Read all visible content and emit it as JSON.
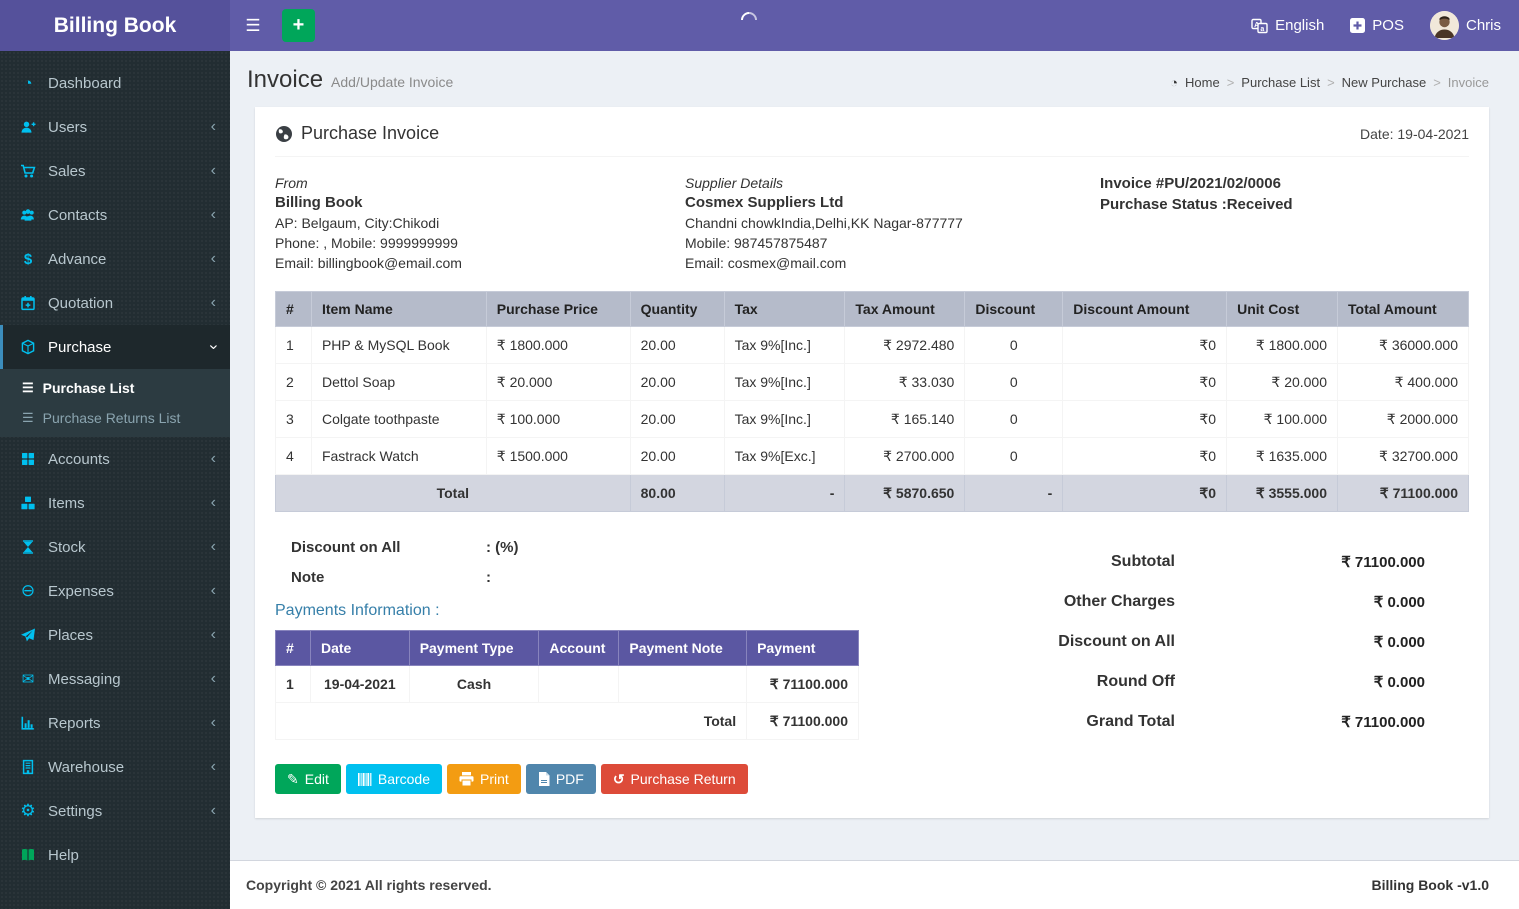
{
  "icons": {
    "hamburger": "☰",
    "plus_sign": "+",
    "chevron_left": "‹",
    "dashboard": "◔",
    "dollar": "$",
    "minus_circle": "⊖",
    "envelope": "✉",
    "gear": "⚙",
    "submenu_list": "☰",
    "edit": "✎",
    "undo": "↺",
    "breadcrumb_home": "◔"
  },
  "header": {
    "brand": "Billing Book",
    "language": "English",
    "pos": "POS",
    "user": "Chris"
  },
  "sidebar": {
    "items": [
      {
        "label": "Dashboard"
      },
      {
        "label": "Users"
      },
      {
        "label": "Sales"
      },
      {
        "label": "Contacts"
      },
      {
        "label": "Advance"
      },
      {
        "label": "Quotation"
      },
      {
        "label": "Purchase"
      },
      {
        "label": "Accounts"
      },
      {
        "label": "Items"
      },
      {
        "label": "Stock"
      },
      {
        "label": "Expenses"
      },
      {
        "label": "Places"
      },
      {
        "label": "Messaging"
      },
      {
        "label": "Reports"
      },
      {
        "label": "Warehouse"
      },
      {
        "label": "Settings"
      },
      {
        "label": "Help"
      }
    ],
    "purchase_submenu": [
      {
        "label": "Purchase List"
      },
      {
        "label": "Purchase Returns List"
      }
    ]
  },
  "page": {
    "title": "Invoice",
    "subtitle": "Add/Update Invoice",
    "breadcrumb": {
      "home": "Home",
      "level1": "Purchase List",
      "level2": "New Purchase",
      "current": "Invoice"
    }
  },
  "invoice": {
    "card_title": "Purchase Invoice",
    "date": "Date: 19-04-2021",
    "from": {
      "heading": "From",
      "name": "Billing Book",
      "line1": "AP: Belgaum, City:Chikodi",
      "line2": "Phone: , Mobile: 9999999999",
      "line3": "Email: billingbook@email.com"
    },
    "supplier": {
      "heading": "Supplier Details",
      "name": "Cosmex Suppliers Ltd",
      "line1": "Chandni chowkIndia,Delhi,KK Nagar-877777",
      "line2": "Mobile: 987457875487",
      "line3": "Email: cosmex@mail.com"
    },
    "meta": {
      "invoice_no": "Invoice #PU/2021/02/0006",
      "status": "Purchase Status :Received"
    },
    "items_table": {
      "headers": [
        "#",
        "Item Name",
        "Purchase Price",
        "Quantity",
        "Tax",
        "Tax Amount",
        "Discount",
        "Discount Amount",
        "Unit Cost",
        "Total Amount"
      ],
      "rows": [
        {
          "n": "1",
          "item": "PHP & MySQL Book",
          "price": "₹ 1800.000",
          "qty": "20.00",
          "tax": "Tax 9%[Inc.]",
          "tax_amount": "₹ 2972.480",
          "discount": "0",
          "discount_amount": "₹0",
          "unit_cost": "₹ 1800.000",
          "total": "₹ 36000.000"
        },
        {
          "n": "2",
          "item": "Dettol Soap",
          "price": "₹ 20.000",
          "qty": "20.00",
          "tax": "Tax 9%[Inc.]",
          "tax_amount": "₹ 33.030",
          "discount": "0",
          "discount_amount": "₹0",
          "unit_cost": "₹ 20.000",
          "total": "₹ 400.000"
        },
        {
          "n": "3",
          "item": "Colgate toothpaste",
          "price": "₹ 100.000",
          "qty": "20.00",
          "tax": "Tax 9%[Inc.]",
          "tax_amount": "₹ 165.140",
          "discount": "0",
          "discount_amount": "₹0",
          "unit_cost": "₹ 100.000",
          "total": "₹ 2000.000"
        },
        {
          "n": "4",
          "item": "Fastrack Watch",
          "price": "₹ 1500.000",
          "qty": "20.00",
          "tax": "Tax 9%[Exc.]",
          "tax_amount": "₹ 2700.000",
          "discount": "0",
          "discount_amount": "₹0",
          "unit_cost": "₹ 1635.000",
          "total": "₹ 32700.000"
        }
      ],
      "total_row": {
        "label": "Total",
        "qty": "80.00",
        "tax": "-",
        "tax_amount": "₹ 5870.650",
        "discount": "-",
        "discount_amount": "₹0",
        "unit_cost": "₹ 3555.000",
        "total": "₹ 71100.000"
      }
    },
    "discount_on_all": {
      "label": "Discount on All",
      "value": ": (%)"
    },
    "note": {
      "label": "Note",
      "value": ":"
    },
    "payments": {
      "heading": "Payments Information :",
      "headers": [
        "#",
        "Date",
        "Payment Type",
        "Account",
        "Payment Note",
        "Payment"
      ],
      "rows": [
        {
          "n": "1",
          "date": "19-04-2021",
          "type": "Cash",
          "account": "",
          "note": "",
          "amount": "₹ 71100.000"
        }
      ],
      "total_label": "Total",
      "total_value": "₹ 71100.000"
    },
    "summary": [
      {
        "label": "Subtotal",
        "value": "₹ 71100.000"
      },
      {
        "label": "Other Charges",
        "value": "₹ 0.000"
      },
      {
        "label": "Discount on All",
        "value": "₹ 0.000"
      },
      {
        "label": "Round Off",
        "value": "₹ 0.000"
      },
      {
        "label": "Grand Total",
        "value": "₹ 71100.000"
      }
    ],
    "actions": {
      "edit": "Edit",
      "barcode": "Barcode",
      "print": "Print",
      "pdf": "PDF",
      "purchase_return": "Purchase Return"
    }
  },
  "footer": {
    "copyright": "Copyright © 2021 All rights reserved.",
    "version": "Billing Book -v1.0"
  },
  "colors": {
    "accent_purple": "#605ca8",
    "sidebar_dark": "#222d32",
    "cyan": "#00c0ef",
    "green": "#00a65a",
    "orange": "#f39c12",
    "red": "#dd4b39",
    "steel_blue": "#5086ac",
    "table_header": "#b5bbca",
    "payments_header": "#5b57a2"
  }
}
